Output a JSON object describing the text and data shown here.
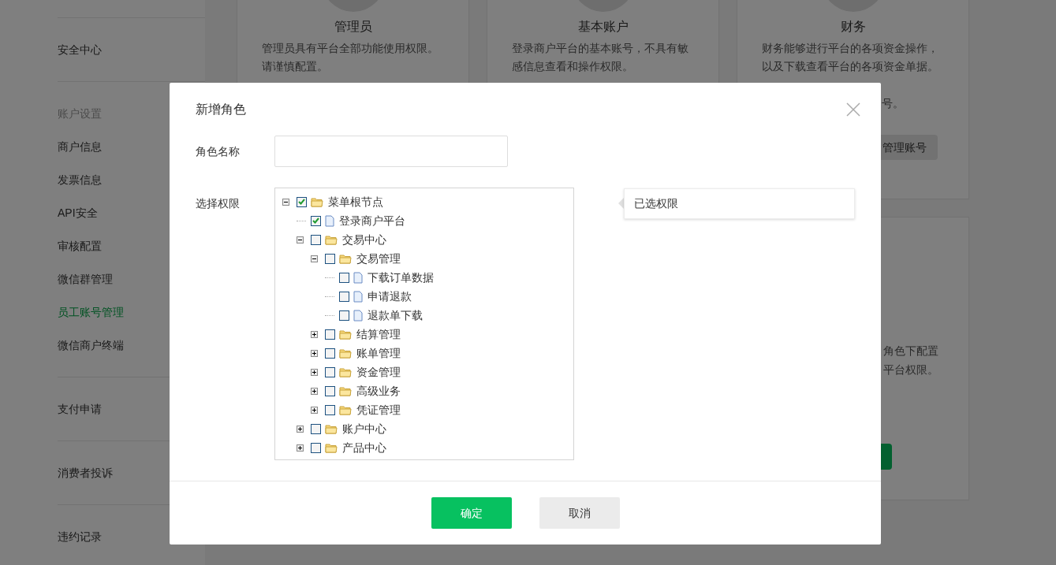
{
  "sidebar": [
    {
      "items": [
        {
          "label": "安全中心",
          "selected": false
        }
      ]
    },
    {
      "header": "账户设置",
      "items": [
        {
          "label": "商户信息",
          "selected": false
        },
        {
          "label": "发票信息",
          "selected": false
        },
        {
          "label": "API安全",
          "selected": false
        },
        {
          "label": "审核配置",
          "selected": false
        },
        {
          "label": "微信群管理",
          "selected": false
        },
        {
          "label": "员工账号管理",
          "selected": true
        },
        {
          "label": "微信商户终端",
          "selected": false
        }
      ]
    },
    {
      "items": [
        {
          "label": "支付申请",
          "selected": false
        }
      ]
    },
    {
      "items": [
        {
          "label": "消费者投诉",
          "selected": false
        }
      ]
    },
    {
      "items": [
        {
          "label": "违约记录",
          "selected": false
        }
      ]
    }
  ],
  "role_cards": [
    {
      "title": "管理员",
      "description": [
        "管理员具有平台全部功能使用权限。",
        "请谨慎配置。"
      ]
    },
    {
      "title": "基本账户",
      "description": [
        "登录商户平台的基本账号，不具有敏",
        "感信息查看和操作权限。"
      ]
    },
    {
      "title": "财务",
      "description": [
        "财务能够进行平台的各项资金操作，",
        "以及下载查看平台的各项资金单据。"
      ],
      "description_tail": "号。",
      "button": "管理账号"
    }
  ],
  "custom_card": {
    "description": [
      "角色下配置",
      "平台权限。"
    ]
  },
  "dialog": {
    "title": "新增角色",
    "role_name": {
      "label": "角色名称"
    },
    "permissions": {
      "label": "选择权限",
      "tree": [
        {
          "label": "菜单根节点",
          "kind": "folder",
          "checked": true,
          "expanded": true,
          "children": [
            {
              "label": "登录商户平台",
              "kind": "file",
              "checked": true
            },
            {
              "label": "交易中心",
              "kind": "folder",
              "checked": false,
              "expanded": true,
              "children": [
                {
                  "label": "交易管理",
                  "kind": "folder",
                  "checked": false,
                  "expanded": true,
                  "children": [
                    {
                      "label": "下载订单数据",
                      "kind": "file",
                      "checked": false
                    },
                    {
                      "label": "申请退款",
                      "kind": "file",
                      "checked": false
                    },
                    {
                      "label": "退款单下载",
                      "kind": "file",
                      "checked": false
                    }
                  ]
                },
                {
                  "label": "结算管理",
                  "kind": "folder",
                  "checked": false,
                  "expanded": false
                },
                {
                  "label": "账单管理",
                  "kind": "folder",
                  "checked": false,
                  "expanded": false
                },
                {
                  "label": "资金管理",
                  "kind": "folder",
                  "checked": false,
                  "expanded": false
                },
                {
                  "label": "高级业务",
                  "kind": "folder",
                  "checked": false,
                  "expanded": false
                },
                {
                  "label": "凭证管理",
                  "kind": "folder",
                  "checked": false,
                  "expanded": false
                }
              ]
            },
            {
              "label": "账户中心",
              "kind": "folder",
              "checked": false,
              "expanded": false
            },
            {
              "label": "产品中心",
              "kind": "folder",
              "checked": false,
              "expanded": false
            }
          ]
        }
      ],
      "selected_title": "已选权限"
    },
    "buttons": [
      {
        "label": "确定",
        "kind": "primary"
      },
      {
        "label": "取消",
        "kind": "secondary"
      }
    ]
  }
}
